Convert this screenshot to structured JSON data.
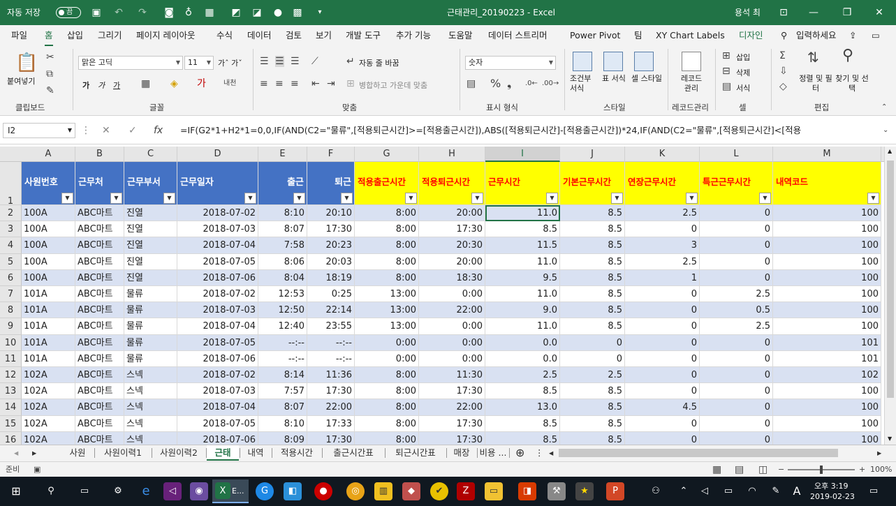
{
  "titlebar": {
    "autosave_label": "자동 저장",
    "autosave_state": "끔",
    "title": "근태관리_20190223  -  Excel",
    "user": "용석 최"
  },
  "menu": {
    "tabs": [
      "파일",
      "홈",
      "삽입",
      "그리기",
      "페이지 레이아웃",
      "수식",
      "데이터",
      "검토",
      "보기",
      "개발 도구",
      "추가 기능",
      "도움말",
      "데이터 스트리머",
      "Power Pivot",
      "팀",
      "XY Chart Labels",
      "디자인"
    ],
    "active": "홈",
    "search": "입력하세요"
  },
  "ribbon": {
    "clipboard": {
      "paste": "붙여넣기",
      "label": "클립보드"
    },
    "font": {
      "name": "맑은 고딕",
      "size": "11",
      "bold": "가",
      "italic": "가",
      "underline": "가",
      "label": "글꼴"
    },
    "align": {
      "wrap": "자동 줄 바꿈",
      "merge": "병합하고 가운데 맞춤",
      "label": "맞춤"
    },
    "number": {
      "format": "숫자",
      "label": "표시 형식"
    },
    "styles": {
      "conditional": "조건부 서식",
      "table": "표 서식",
      "cell": "셀 스타일",
      "label": "스타일"
    },
    "record": {
      "label_btn": "레코드 관리",
      "label": "레코드관리"
    },
    "cells": {
      "insert": "삽입",
      "delete": "삭제",
      "format": "서식",
      "label": "셀"
    },
    "editing": {
      "sort": "정렬 및 필터",
      "find": "찾기 및 선택",
      "label": "편집"
    }
  },
  "formula_bar": {
    "name_box": "I2",
    "formula": "=IF(G2*1+H2*1=0,0,IF(AND(C2=\"물류\",[적용퇴근시간]>=[적용출근시간]),ABS([적용퇴근시간]-[적용출근시간])*24,IF(AND(C2=\"물류\",[적용퇴근시간]<[적용"
  },
  "grid": {
    "columns": [
      "A",
      "B",
      "C",
      "D",
      "E",
      "F",
      "G",
      "H",
      "I",
      "J",
      "K",
      "L",
      "M"
    ],
    "selected_column": "I",
    "headers": [
      "사원번호",
      "근무처",
      "근무부서",
      "근무일자",
      "출근",
      "퇴근",
      "적용출근시간",
      "적용퇴근시간",
      "근무시간",
      "기본근무시간",
      "연장근무시간",
      "특근근무시간",
      "내역코드"
    ],
    "rows": [
      [
        "100A",
        "ABC마트",
        "진열",
        "2018-07-02",
        "8:10",
        "20:10",
        "8:00",
        "20:00",
        "11.0",
        "8.5",
        "2.5",
        "0",
        "100"
      ],
      [
        "100A",
        "ABC마트",
        "진열",
        "2018-07-03",
        "8:07",
        "17:30",
        "8:00",
        "17:30",
        "8.5",
        "8.5",
        "0",
        "0",
        "100"
      ],
      [
        "100A",
        "ABC마트",
        "진열",
        "2018-07-04",
        "7:58",
        "20:23",
        "8:00",
        "20:30",
        "11.5",
        "8.5",
        "3",
        "0",
        "100"
      ],
      [
        "100A",
        "ABC마트",
        "진열",
        "2018-07-05",
        "8:06",
        "20:03",
        "8:00",
        "20:00",
        "11.0",
        "8.5",
        "2.5",
        "0",
        "100"
      ],
      [
        "100A",
        "ABC마트",
        "진열",
        "2018-07-06",
        "8:04",
        "18:19",
        "8:00",
        "18:30",
        "9.5",
        "8.5",
        "1",
        "0",
        "100"
      ],
      [
        "101A",
        "ABC마트",
        "물류",
        "2018-07-02",
        "12:53",
        "0:25",
        "13:00",
        "0:00",
        "11.0",
        "8.5",
        "0",
        "2.5",
        "100"
      ],
      [
        "101A",
        "ABC마트",
        "물류",
        "2018-07-03",
        "12:50",
        "22:14",
        "13:00",
        "22:00",
        "9.0",
        "8.5",
        "0",
        "0.5",
        "100"
      ],
      [
        "101A",
        "ABC마트",
        "물류",
        "2018-07-04",
        "12:40",
        "23:55",
        "13:00",
        "0:00",
        "11.0",
        "8.5",
        "0",
        "2.5",
        "100"
      ],
      [
        "101A",
        "ABC마트",
        "물류",
        "2018-07-05",
        "--:--",
        "--:--",
        "0:00",
        "0:00",
        "0.0",
        "0",
        "0",
        "0",
        "101"
      ],
      [
        "101A",
        "ABC마트",
        "물류",
        "2018-07-06",
        "--:--",
        "--:--",
        "0:00",
        "0:00",
        "0.0",
        "0",
        "0",
        "0",
        "101"
      ],
      [
        "102A",
        "ABC마트",
        "스넥",
        "2018-07-02",
        "8:14",
        "11:36",
        "8:00",
        "11:30",
        "2.5",
        "2.5",
        "0",
        "0",
        "102"
      ],
      [
        "102A",
        "ABC마트",
        "스넥",
        "2018-07-03",
        "7:57",
        "17:30",
        "8:00",
        "17:30",
        "8.5",
        "8.5",
        "0",
        "0",
        "100"
      ],
      [
        "102A",
        "ABC마트",
        "스넥",
        "2018-07-04",
        "8:07",
        "22:00",
        "8:00",
        "22:00",
        "13.0",
        "8.5",
        "4.5",
        "0",
        "100"
      ],
      [
        "102A",
        "ABC마트",
        "스넥",
        "2018-07-05",
        "8:10",
        "17:33",
        "8:00",
        "17:30",
        "8.5",
        "8.5",
        "0",
        "0",
        "100"
      ],
      [
        "102A",
        "ABC마트",
        "스넥",
        "2018-07-06",
        "8:09",
        "17:30",
        "8:00",
        "17:30",
        "8.5",
        "8.5",
        "0",
        "0",
        "100"
      ]
    ]
  },
  "sheets": {
    "tabs": [
      "사원",
      "사원이력1",
      "사원이력2",
      "근태",
      "내역",
      "적용시간",
      "출근시간표",
      "퇴근시간표",
      "매장",
      "비용 ..."
    ],
    "active": "근태"
  },
  "status": {
    "ready": "준비",
    "zoom": "100%"
  },
  "taskbar": {
    "time": "오후 3:19",
    "date": "2019-02-23",
    "excel_label": "E..."
  },
  "colors": {
    "excel_green": "#217346",
    "header_blue": "#4472c4",
    "header_yellow": "#ffff00",
    "header_red_text": "#ff0000",
    "band_blue": "#d9e1f2"
  }
}
